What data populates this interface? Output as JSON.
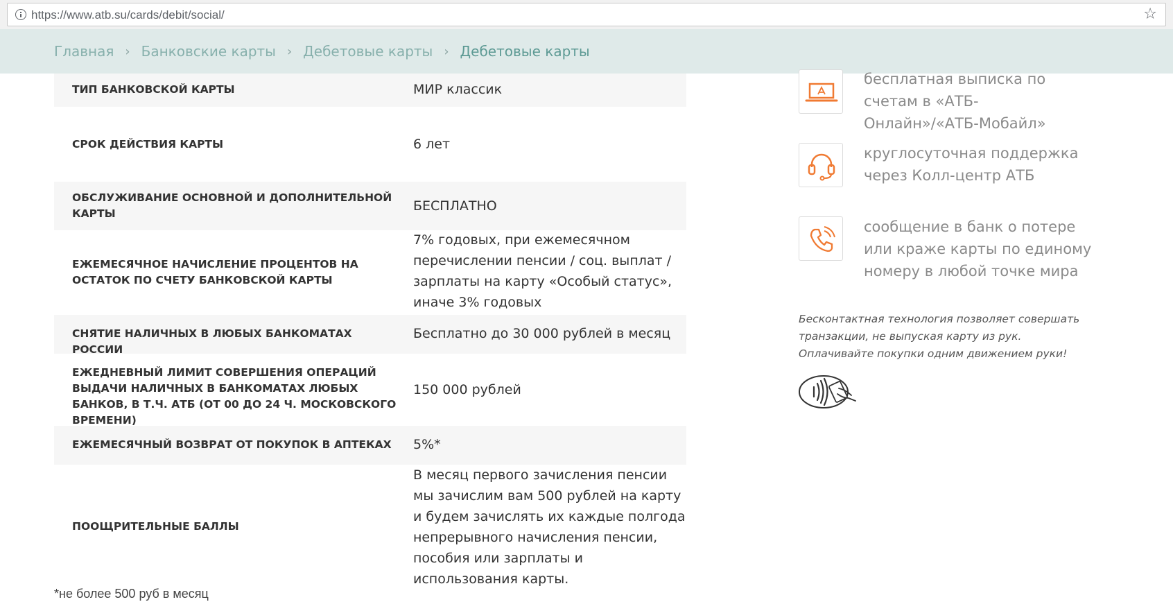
{
  "browser": {
    "url": "https://www.atb.su/cards/debit/social/",
    "icons": {
      "info": "info-circle-icon",
      "bookmark": "star-icon"
    },
    "star_glyph": "☆"
  },
  "breadcrumb": {
    "items": [
      {
        "label": "Главная"
      },
      {
        "label": "Банковские карты"
      },
      {
        "label": "Дебетовые карты"
      },
      {
        "label": "Дебетовые карты"
      }
    ],
    "separator": "›"
  },
  "card_table": {
    "rows": [
      {
        "label": "ТИП БАНКОВСКОЙ КАРТЫ",
        "value": "МИР классик"
      },
      {
        "label": "СРОК ДЕЙСТВИЯ КАРТЫ",
        "value": "6 лет"
      },
      {
        "label": "ОБСЛУЖИВАНИЕ ОСНОВНОЙ И ДОПОЛНИТЕЛЬНОЙ КАРТЫ",
        "value": "БЕСПЛАТНО"
      },
      {
        "label": "ЕЖЕМЕСЯЧНОЕ НАЧИСЛЕНИЕ ПРОЦЕНТОВ НА ОСТАТОК ПО СЧЕТУ БАНКОВСКОЙ КАРТЫ",
        "value": "7% годовых, при ежемесячном перечислении пенсии / соц. выплат / зарплаты на карту «Особый статус», иначе 3% годовых"
      },
      {
        "label": "СНЯТИЕ НАЛИЧНЫХ В ЛЮБЫХ БАНКОМАТАХ РОССИИ",
        "value": "Бесплатно до 30 000 рублей в месяц"
      },
      {
        "label": "ЕЖЕДНЕВНЫЙ ЛИМИТ СОВЕРШЕНИЯ ОПЕРАЦИЙ ВЫДАЧИ НАЛИЧНЫХ В БАНКОМАТАХ ЛЮБЫХ БАНКОВ, В Т.Ч. АТБ (ОТ 00 ДО 24 Ч. МОСКОВСКОГО ВРЕМЕНИ)",
        "value": "150 000 рублей"
      },
      {
        "label": "ЕЖЕМЕСЯЧНЫЙ ВОЗВРАТ ОТ ПОКУПОК В АПТЕКАХ",
        "value": "5%*"
      },
      {
        "label": "ПООЩРИТЕЛЬНЫЕ БАЛЛЫ",
        "value": "В месяц первого зачисления пенсии мы зачислим вам 500 рублей на карту и будем зачислять их каждые полгода непрерывного начисления пенсии, пособия или зарплаты и использования карты."
      }
    ],
    "footnote": "*не более 500 руб в месяц"
  },
  "features": [
    {
      "icon": "laptop-icon",
      "text": "бесплатная выписка по счетам в «АТБ-Онлайн»/«АТБ-Мобайл»"
    },
    {
      "icon": "headset-icon",
      "text": "круглосуточная поддержка через Колл-центр АТБ"
    },
    {
      "icon": "phone-icon",
      "text": "сообщение в банк о потере или краже карты по единому номеру в любой точке мира"
    }
  ],
  "contactless": {
    "text": "Бесконтактная технология позволяет совершать транзакции, не выпуская карту из рук. Оплачивайте покупки одним движением руки!",
    "icon": "contactless-payment-icon"
  },
  "colors": {
    "breadcrumb_bg": "#dfeae9",
    "breadcrumb_link": "#87b0ac",
    "breadcrumb_current": "#5d9a94",
    "row_shade": "#f6f6f6",
    "icon_accent": "#f07a32",
    "feature_text": "#8a8a8a"
  }
}
